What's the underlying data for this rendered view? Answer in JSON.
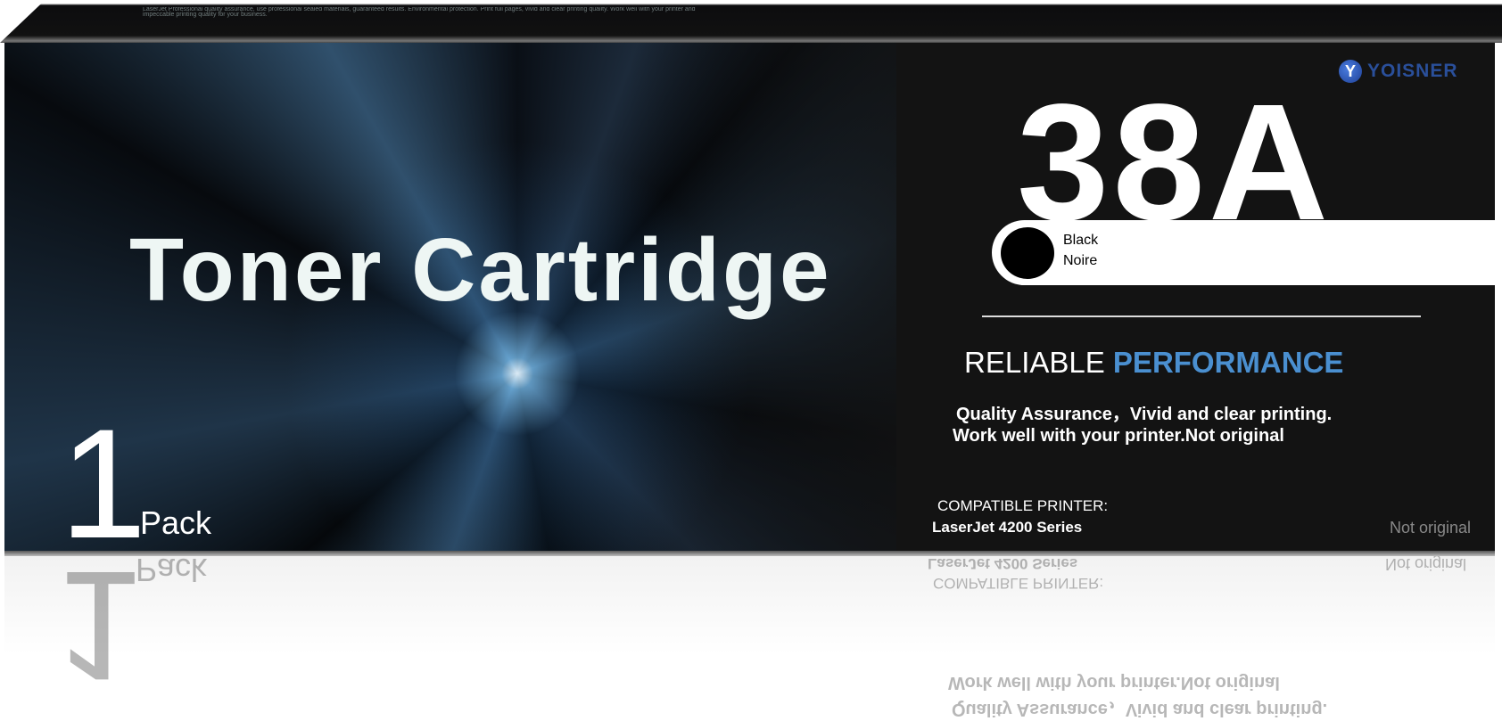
{
  "lid_text": "LaserJet Professional quality assurance, use professional sealed materials, guaranteed results. Environmental protection. Print full pages, vivid and clear printing quality. Work well with your printer and impeccable printing quality for your business.",
  "title": "Toner Cartridge",
  "pack": {
    "count": "1",
    "label": "Pack"
  },
  "model": "38A",
  "brand": {
    "mark": "Y",
    "name": "YOISNER",
    "color": "#2a4f9a"
  },
  "color": {
    "line1": "Black",
    "line2": "Noire"
  },
  "headline": {
    "part1": "RELIABLE",
    "part2": "PERFORMANCE",
    "accent": "#4a8fd0"
  },
  "features": [
    "Quality Assurance，Vivid and clear printing.",
    "Work well with your printer.Not original"
  ],
  "compatible": {
    "label": "COMPATIBLE PRINTER:",
    "printer": "LaserJet 4200 Series"
  },
  "disclaimer": "Not original"
}
